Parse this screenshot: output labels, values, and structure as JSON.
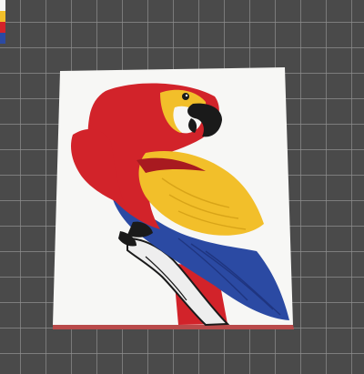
{
  "scene": {
    "title": "",
    "subject": "parrot-multicolor-print",
    "plate_background": "#4a4a4a",
    "grid_line_color": "#9a9a9a",
    "grid_line_dark": "#3a3a3a"
  },
  "palette": {
    "white": "#f7f7f5",
    "red": "#d2232a",
    "red_dark": "#a81a20",
    "yellow": "#f2bf2a",
    "blue": "#2b4aa3",
    "blue_dark": "#1f3580",
    "black": "#1a1a1a",
    "base_edge": "#b94a4a"
  },
  "corner_filament_swatches": [
    "#f7f7f5",
    "#f2bf2a",
    "#d2232a",
    "#2b4aa3"
  ]
}
